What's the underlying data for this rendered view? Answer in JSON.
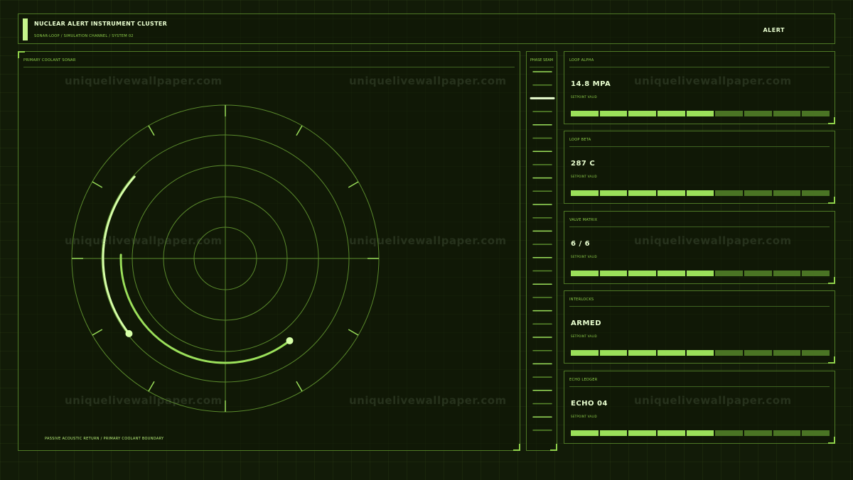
{
  "header": {
    "title": "NUCLEAR ALERT INSTRUMENT CLUSTER",
    "subtitle": "SONAR-LOOP / SIMULATION CHANNEL / SYSTEM 02",
    "alert": "ALERT"
  },
  "sonar": {
    "title": "PRIMARY COOLANT SONAR",
    "caption": "PASSIVE ACOUSTIC RETURN / PRIMARY COOLANT BOUNDARY"
  },
  "phase": {
    "title": "PHASE SEAM"
  },
  "cards": [
    {
      "title": "LOOP ALPHA",
      "value": "14.8 MPA",
      "status": "SETPOINT VALID",
      "level": 0.5
    },
    {
      "title": "LOOP BETA",
      "value": "287 C",
      "status": "SETPOINT VALID",
      "level": 0.5
    },
    {
      "title": "VALVE MATRIX",
      "value": "6 / 6",
      "status": "SETPOINT VALID",
      "level": 0.5
    },
    {
      "title": "INTERLOCKS",
      "value": "ARMED",
      "status": "SETPOINT VALID",
      "level": 0.5
    },
    {
      "title": "ECHO LEDGER",
      "value": "ECHO 04",
      "status": "SETPOINT VALID",
      "level": 0.5
    }
  ],
  "watermark": "uniquelivewallpaper.com",
  "colors": {
    "background": "#121b08",
    "accent": "#9be05a",
    "accent_bright": "#c6f58c",
    "text_bright": "#e9ffd0",
    "segment_off": "#4a7424"
  }
}
